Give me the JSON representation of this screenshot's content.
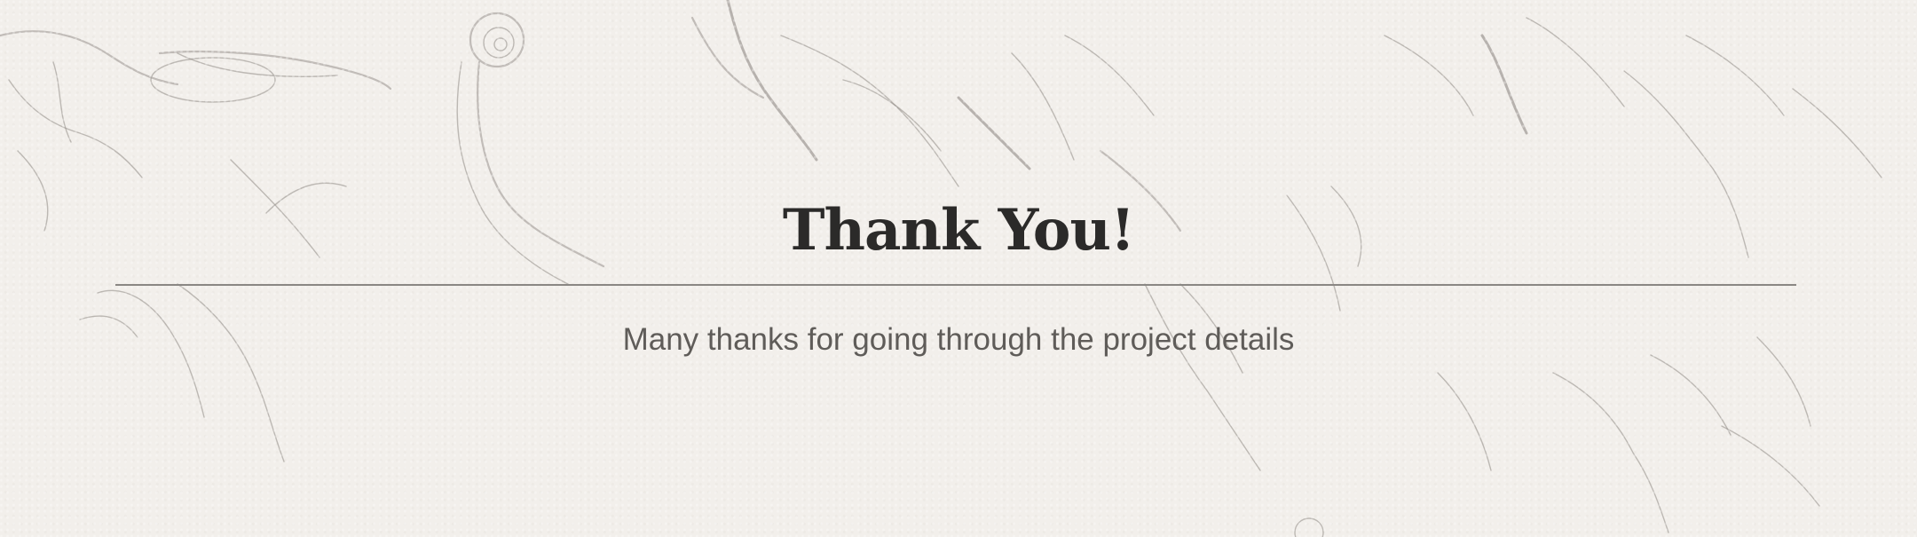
{
  "slide": {
    "title": "Thank You!",
    "subtitle": "Many thanks for going through the project details"
  },
  "theme": {
    "background": "#f2efeb",
    "title_color": "#2b2a29",
    "subtitle_color": "#5f5c59",
    "divider_color": "#8a8784"
  }
}
